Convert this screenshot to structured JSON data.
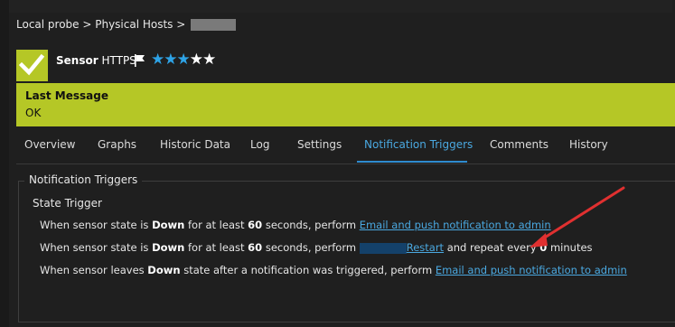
{
  "breadcrumb": "Local probe > Physical Hosts >",
  "sensor": {
    "name": "Sensor",
    "type": "HTTPS",
    "rating": 3,
    "rating_max": 5
  },
  "status": {
    "label": "Last Message",
    "value": "OK"
  },
  "tabs": [
    {
      "label": "Overview"
    },
    {
      "label": "Graphs"
    },
    {
      "label": "Historic Data"
    },
    {
      "label": "Log"
    },
    {
      "label": "Settings"
    },
    {
      "label": "Notification Triggers",
      "active": true
    },
    {
      "label": "Comments"
    },
    {
      "label": "History"
    }
  ],
  "section": {
    "title": "Notification Triggers",
    "subtitle": "State Trigger"
  },
  "triggers": [
    {
      "prefix": "When sensor state is",
      "state": "Down",
      "mid1": "for at least",
      "seconds": "60",
      "mid2": "seconds, perform",
      "action": "Email and push notification to admin"
    },
    {
      "prefix": "When sensor state is",
      "state": "Down",
      "mid1": "for at least",
      "seconds": "60",
      "mid2": "seconds, perform",
      "action": "Restart",
      "repeat_prefix": "and repeat every",
      "repeat_value": "0",
      "repeat_suffix": "minutes"
    },
    {
      "prefix": "When sensor leaves",
      "state": "Down",
      "mid": "state after a notification was triggered, perform",
      "action": "Email and push notification to admin"
    }
  ],
  "colors": {
    "status": "#b5c726",
    "accent": "#2ea3e6",
    "link": "#4aa8e0",
    "annotation": "#e03030"
  },
  "icons": [
    "check-icon",
    "flag-icon",
    "star-icon",
    "arrow-annotation"
  ]
}
